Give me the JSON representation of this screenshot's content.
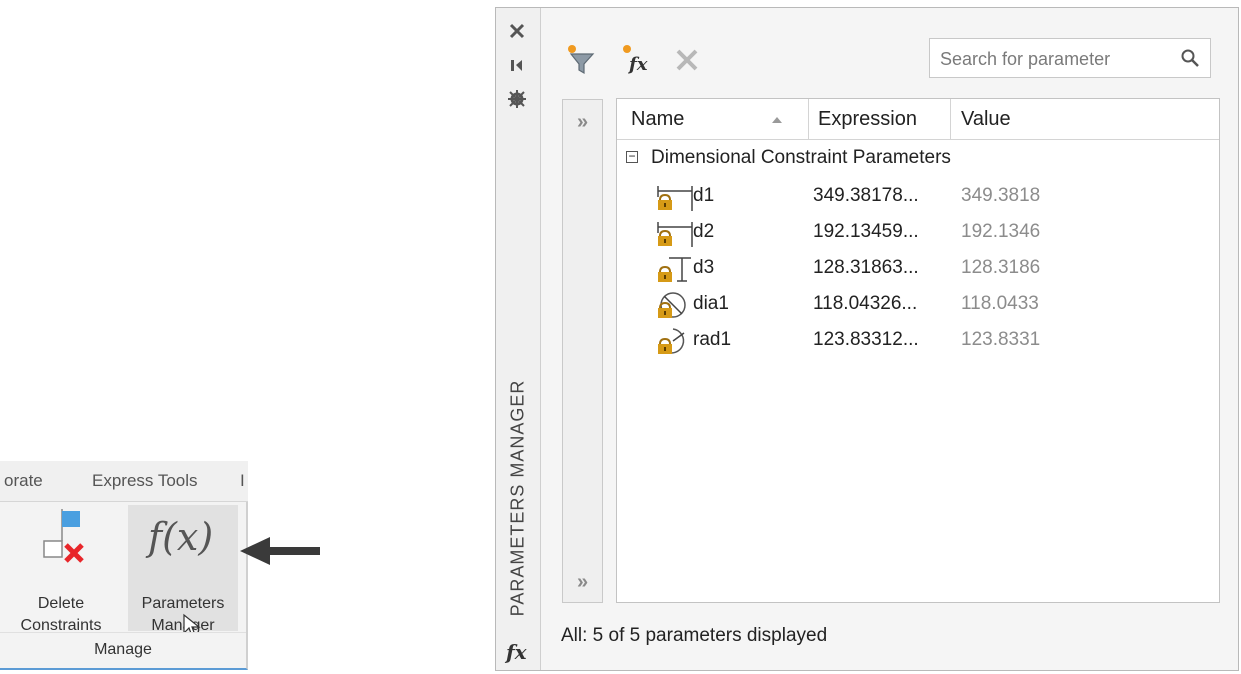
{
  "ribbon": {
    "tabs": [
      "orate",
      "Express Tools",
      "I"
    ],
    "delete_label_1": "Delete",
    "delete_label_2": "Constraints",
    "params_label_1": "Parameters",
    "params_label_2": "Manager",
    "panel_label": "Manage",
    "fx_glyph": "f(x)"
  },
  "palette": {
    "title": "PARAMETERS MANAGER",
    "search_placeholder": "Search for parameter",
    "columns": [
      "Name",
      "Expression",
      "Value"
    ],
    "group_label": "Dimensional Constraint Parameters",
    "group_toggle": "−",
    "expand_glyph": "»",
    "parameters": [
      {
        "name": "d1",
        "expression": "349.38178...",
        "value": "349.3818",
        "icon": "linear-dimension-icon"
      },
      {
        "name": "d2",
        "expression": "192.13459...",
        "value": "192.1346",
        "icon": "linear-dimension-icon"
      },
      {
        "name": "d3",
        "expression": "128.31863...",
        "value": "128.3186",
        "icon": "vertical-dimension-icon"
      },
      {
        "name": "dia1",
        "expression": "118.04326...",
        "value": "118.0433",
        "icon": "diameter-dimension-icon"
      },
      {
        "name": "rad1",
        "expression": "123.83312...",
        "value": "123.8331",
        "icon": "radius-dimension-icon"
      }
    ],
    "status": "All: 5 of 5 parameters displayed",
    "fx_glyph": "fx"
  },
  "colors": {
    "accent_blue": "#4a9fe0",
    "delete_red": "#e8262a",
    "lock_gold": "#d69a16",
    "tool_orange": "#f09a20"
  }
}
